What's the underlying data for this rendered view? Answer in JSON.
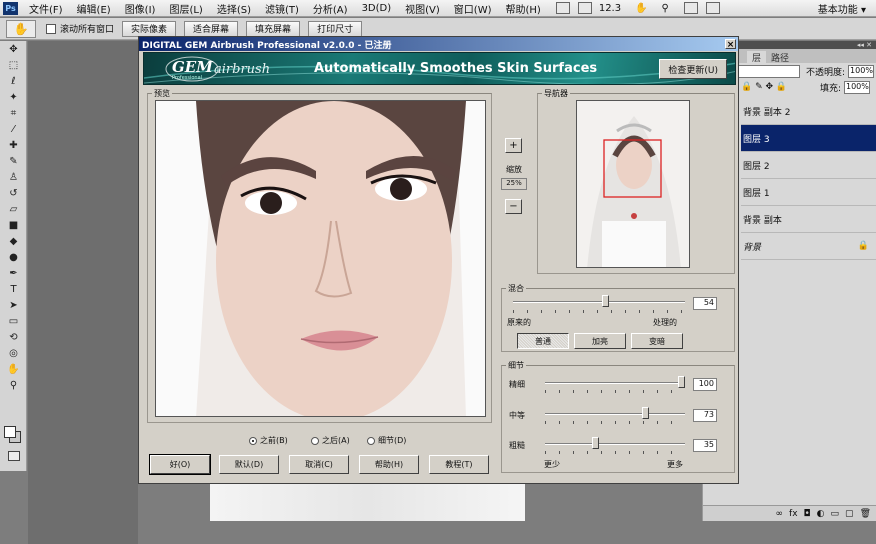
{
  "menubar": {
    "logo": "Ps",
    "items": [
      "文件(F)",
      "编辑(E)",
      "图像(I)",
      "图层(L)",
      "选择(S)",
      "滤镜(T)",
      "分析(A)",
      "3D(D)",
      "视图(V)",
      "窗口(W)",
      "帮助(H)"
    ],
    "zoom": "12.3",
    "workspace": "基本功能"
  },
  "optionsbar": {
    "scroll_all_label": "滚动所有窗口",
    "buttons": [
      "实际像素",
      "适合屏幕",
      "填充屏幕",
      "打印尺寸"
    ]
  },
  "panels": {
    "tabs": [
      "层",
      "路径"
    ],
    "opacity_label": "不透明度:",
    "opacity_value": "100%",
    "fill_label": "填充:",
    "fill_value": "100%",
    "layers": [
      "背景 副本 2",
      "图层 3",
      "图层 2",
      "图层 1",
      "背景 副本",
      "背景"
    ],
    "selected_layer": "图层 3"
  },
  "dialog": {
    "title": "DIGITAL GEM Airbrush Professional v2.0.0 - 已注册",
    "banner_logo": "GEM",
    "banner_logo2": "airbrush",
    "banner_sub": "Professional",
    "banner_tagline": "Automatically Smoothes Skin Surfaces",
    "update_button": "检查更新(U)",
    "preview_label": "预览",
    "navigator_label": "导航器",
    "zoom_in": "+",
    "zoom_out": "−",
    "zoom_label": "缩放",
    "zoom_value": "25%",
    "blend": {
      "label": "混合",
      "value": "54",
      "fraction": 0.54,
      "left_label": "原来的",
      "right_label": "处理的",
      "modes": [
        "普通",
        "加亮",
        "变暗"
      ],
      "active_mode": "普通"
    },
    "detail": {
      "label": "细节",
      "rows": [
        {
          "label": "精细",
          "value": "100",
          "fraction": 1.0
        },
        {
          "label": "中等",
          "value": "73",
          "fraction": 0.73
        },
        {
          "label": "粗糙",
          "value": "35",
          "fraction": 0.35
        }
      ],
      "less_label": "更少",
      "more_label": "更多"
    },
    "radios": [
      {
        "label": "之前(B)",
        "checked": true
      },
      {
        "label": "之后(A)",
        "checked": false
      },
      {
        "label": "细节(D)",
        "checked": false
      }
    ],
    "buttons": [
      "好(O)",
      "默认(D)",
      "取消(C)",
      "帮助(H)",
      "教程(T)"
    ]
  }
}
